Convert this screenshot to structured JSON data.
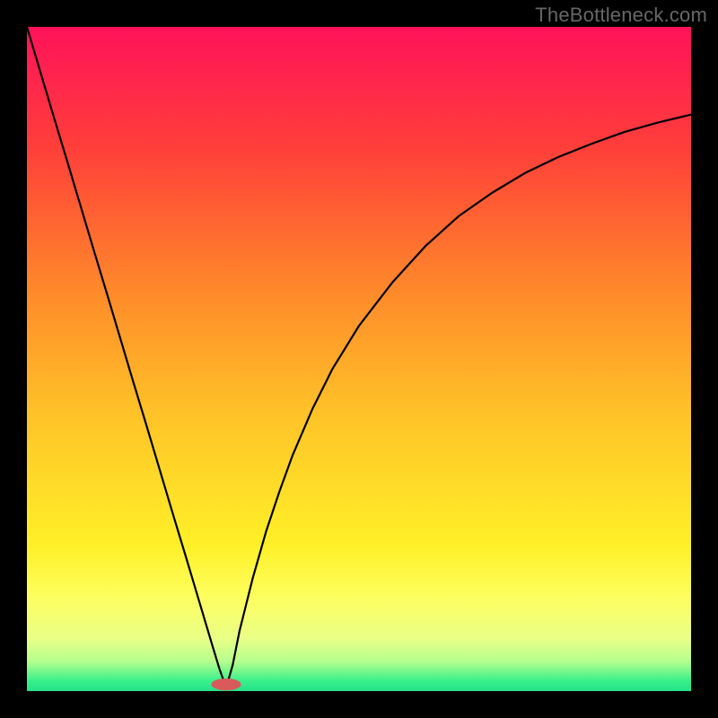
{
  "watermark": {
    "text": "TheBottleneck.com"
  },
  "chart_data": {
    "type": "line",
    "title": "",
    "xlabel": "",
    "ylabel": "",
    "xlim": [
      0,
      100
    ],
    "ylim": [
      0,
      100
    ],
    "grid": false,
    "background_gradient": {
      "stops": [
        {
          "offset": 0.0,
          "color": "#ff125a"
        },
        {
          "offset": 0.18,
          "color": "#ff3e3a"
        },
        {
          "offset": 0.4,
          "color": "#ff8a2a"
        },
        {
          "offset": 0.58,
          "color": "#ffc228"
        },
        {
          "offset": 0.78,
          "color": "#fff028"
        },
        {
          "offset": 0.86,
          "color": "#fdff60"
        },
        {
          "offset": 0.92,
          "color": "#eaff86"
        },
        {
          "offset": 0.955,
          "color": "#b6ff8e"
        },
        {
          "offset": 0.985,
          "color": "#38f08a"
        },
        {
          "offset": 1.0,
          "color": "#24e28a"
        }
      ]
    },
    "marker": {
      "x": 30,
      "y": 1,
      "shape": "pill",
      "color": "#d85a5a",
      "width_frac": 0.045,
      "height_frac": 0.018
    },
    "series": [
      {
        "name": "curve",
        "x": [
          0,
          2,
          4,
          6,
          8,
          10,
          12,
          14,
          16,
          18,
          20,
          22,
          24,
          26,
          28,
          29,
          30,
          31,
          32,
          34,
          36,
          38,
          40,
          43,
          46,
          50,
          55,
          60,
          65,
          70,
          75,
          80,
          85,
          90,
          95,
          100
        ],
        "y": [
          100,
          93.3,
          86.6,
          80.0,
          73.3,
          66.6,
          60.0,
          53.3,
          46.6,
          40.0,
          33.3,
          26.6,
          20.0,
          13.3,
          6.6,
          3.3,
          0.5,
          4.0,
          9.0,
          17.0,
          24.0,
          30.0,
          35.5,
          42.5,
          48.5,
          55.0,
          61.5,
          67.0,
          71.5,
          75.0,
          78.0,
          80.4,
          82.4,
          84.2,
          85.6,
          86.8
        ]
      }
    ]
  }
}
